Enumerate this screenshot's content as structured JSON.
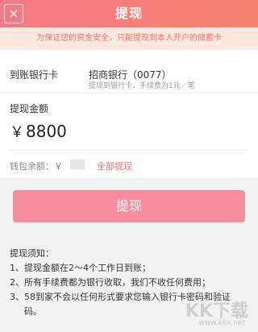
{
  "header": {
    "title": "提现",
    "close_icon": "close-icon",
    "close_glyph": "×",
    "gradient_start": "#f37a86",
    "gradient_end": "#f4836e"
  },
  "notice": {
    "text": "为保证您的资金安全，只能提现到本人开户的储蓄卡"
  },
  "bank": {
    "label": "到账银行卡",
    "name": "招商银行（0077）",
    "fee": "提现到银行卡，手续费为1元／笔"
  },
  "amount": {
    "label": "提现金额",
    "currency": "￥",
    "value": "8800"
  },
  "balance": {
    "label": "钱包余额：￥",
    "withdraw_all": "全部提现"
  },
  "submit": {
    "label": "提现",
    "color": "#f58c9d"
  },
  "notes": {
    "title": "提现须知：",
    "items": [
      "1、提现金额在2～4个工作日到账；",
      "2、所有手续费都为银行收取，我们不收任何费用；",
      "3、58到家不会以任何形式要求您输入银行卡密码和验证",
      "码。"
    ]
  },
  "watermark": {
    "text": "KK下载",
    "url": "www.kkx.net"
  },
  "colors": {
    "accent": "#f1706e",
    "background": "#f2f2f2"
  }
}
